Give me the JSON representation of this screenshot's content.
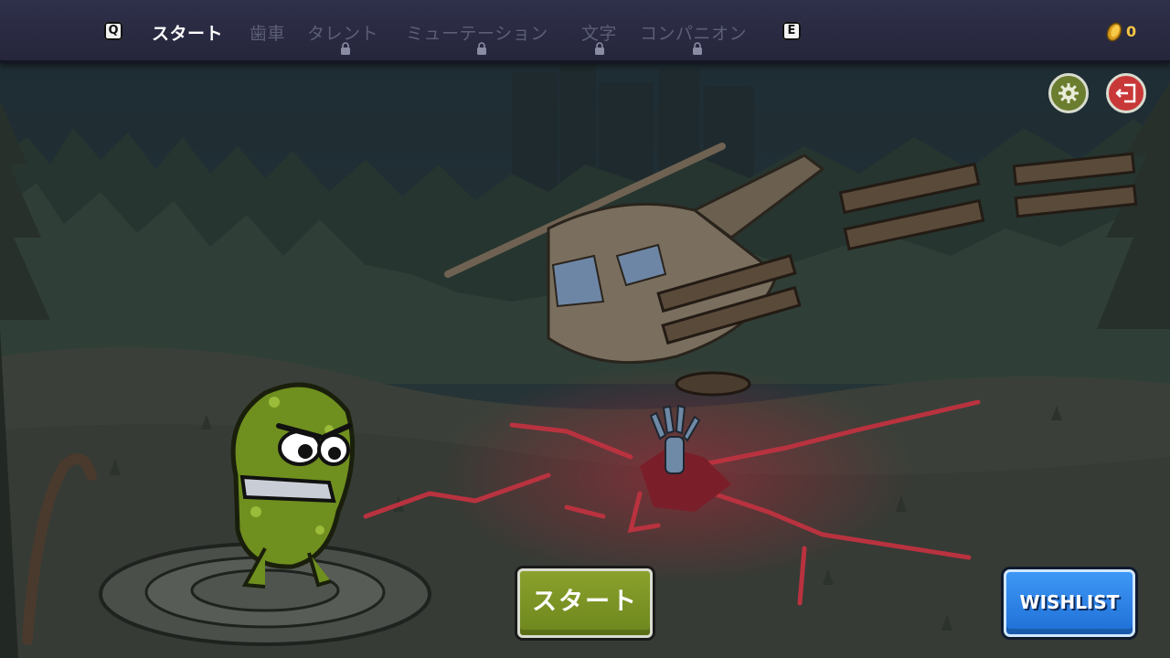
{
  "hotkeys": {
    "prev": "Q",
    "next": "E"
  },
  "tabs": [
    {
      "label": "スタート",
      "active": true,
      "locked": false
    },
    {
      "label": "歯車",
      "active": false,
      "locked": false
    },
    {
      "label": "タレント",
      "active": false,
      "locked": true
    },
    {
      "label": "ミューテーション",
      "active": false,
      "locked": true
    },
    {
      "label": "文字",
      "active": false,
      "locked": true
    },
    {
      "label": "コンパニオン",
      "active": false,
      "locked": true
    }
  ],
  "currency": {
    "icon": "coin-icon",
    "amount": "0"
  },
  "corner_buttons": {
    "settings_icon": "gear-icon",
    "exit_icon": "exit-door-icon"
  },
  "start_button": {
    "label": "スタート"
  },
  "wishlist_button": {
    "label": "WISHLIST"
  },
  "colors": {
    "topbar": "#2a2b42",
    "tab_active": "#ffffff",
    "tab_inactive": "#5d5f77",
    "start_button": "#7e9624",
    "wishlist_button": "#2f83ea",
    "coin": "#f5c542"
  }
}
